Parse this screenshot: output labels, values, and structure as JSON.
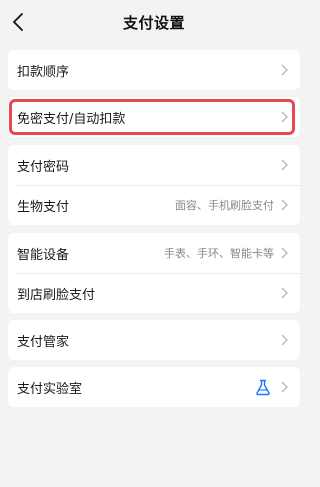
{
  "header": {
    "title": "支付设置",
    "back_icon": "chevron-left-icon"
  },
  "groups": [
    {
      "items": [
        {
          "label": "扣款顺序",
          "value": ""
        }
      ]
    },
    {
      "items": [
        {
          "label": "免密支付/自动扣款",
          "value": "",
          "highlighted": true
        }
      ]
    },
    {
      "items": [
        {
          "label": "支付密码",
          "value": ""
        },
        {
          "label": "生物支付",
          "value": "面容、手机刷脸支付"
        }
      ]
    },
    {
      "items": [
        {
          "label": "智能设备",
          "value": "手表、手环、智能卡等"
        },
        {
          "label": "到店刷脸支付",
          "value": ""
        }
      ]
    },
    {
      "items": [
        {
          "label": "支付管家",
          "value": ""
        }
      ]
    },
    {
      "items": [
        {
          "label": "支付实验室",
          "value": "",
          "icon": "flask-icon"
        }
      ]
    }
  ],
  "colors": {
    "background": "#f3f3f3",
    "card": "#ffffff",
    "highlight_border": "#e34a50",
    "flask_icon": "#1677ff",
    "chevron": "#b5b5b5"
  }
}
